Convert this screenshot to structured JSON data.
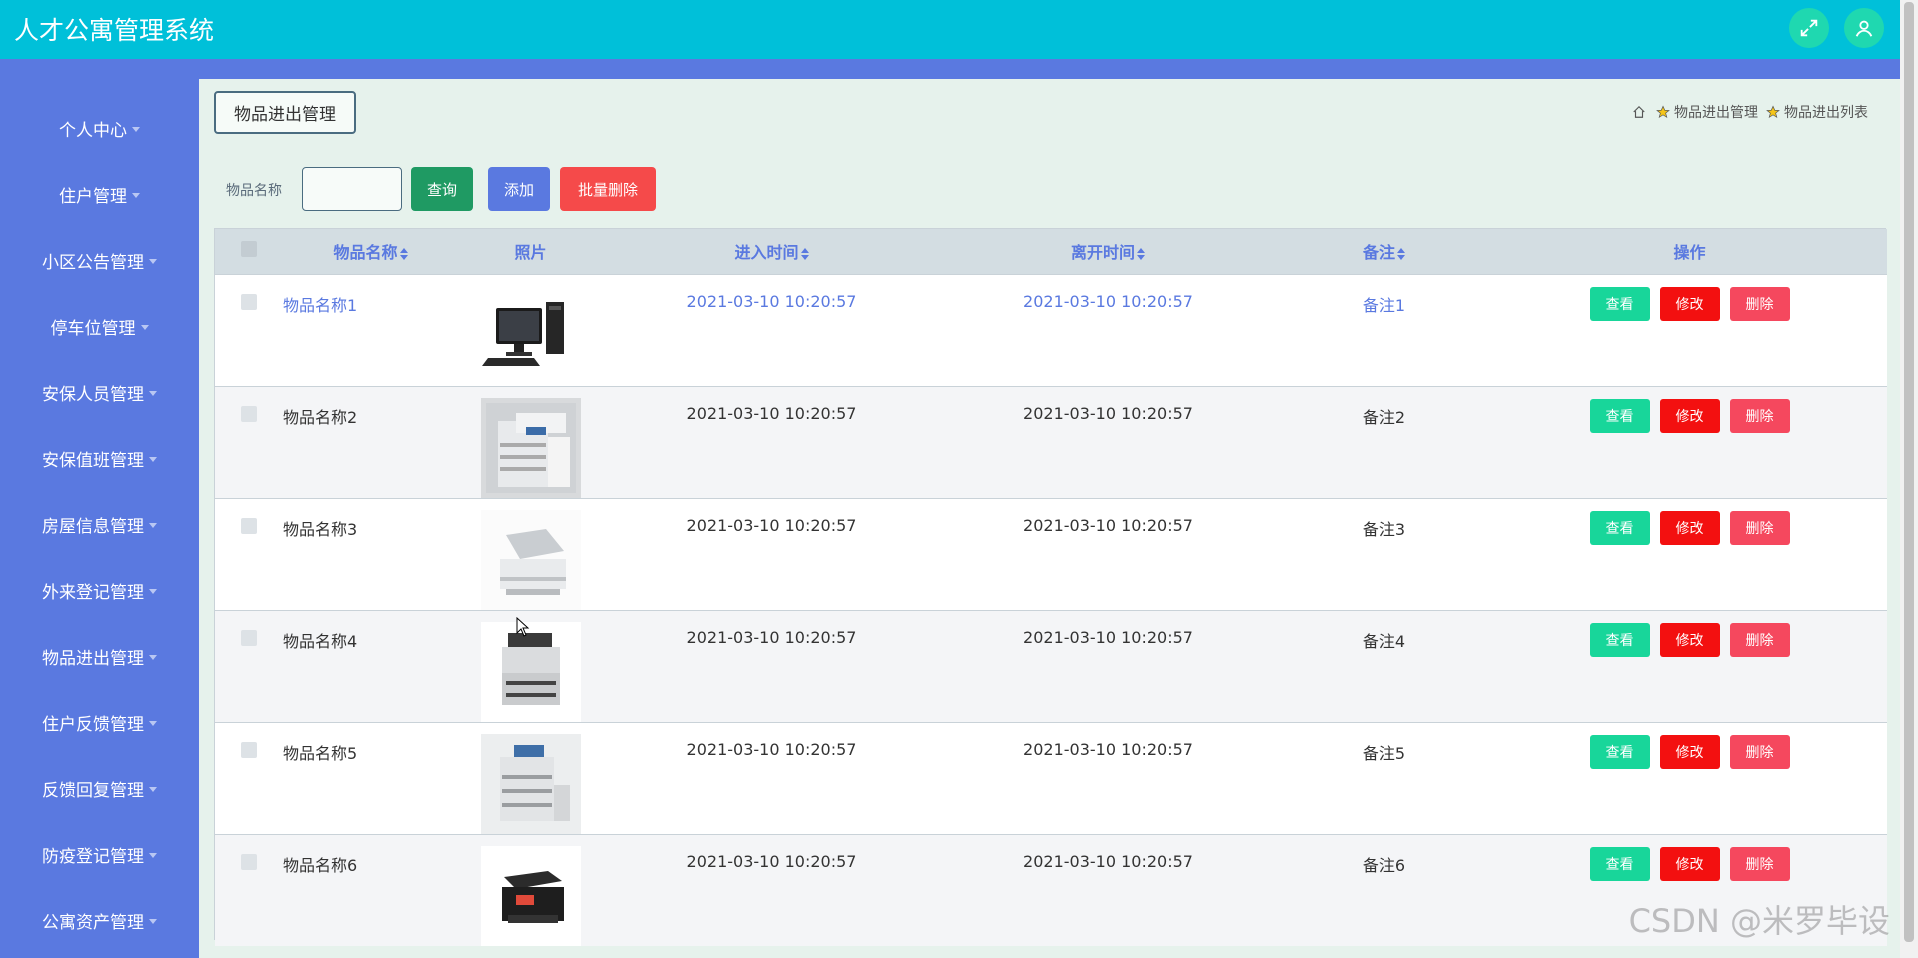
{
  "header": {
    "title": "人才公寓管理系统",
    "fullscreen_icon": "fullscreen-icon",
    "user_icon": "user-icon"
  },
  "sidebar": {
    "items": [
      {
        "label": "个人中心"
      },
      {
        "label": "住户管理"
      },
      {
        "label": "小区公告管理"
      },
      {
        "label": "停车位管理"
      },
      {
        "label": "安保人员管理"
      },
      {
        "label": "安保值班管理"
      },
      {
        "label": "房屋信息管理"
      },
      {
        "label": "外来登记管理"
      },
      {
        "label": "物品进出管理"
      },
      {
        "label": "住户反馈管理"
      },
      {
        "label": "反馈回复管理"
      },
      {
        "label": "防疫登记管理"
      },
      {
        "label": "公寓资产管理"
      }
    ]
  },
  "main": {
    "page_tag": "物品进出管理",
    "breadcrumb": {
      "items": [
        "物品进出管理",
        "物品进出列表"
      ]
    },
    "search": {
      "label": "物品名称",
      "value": "",
      "query_label": "查询",
      "add_label": "添加",
      "batch_delete_label": "批量删除"
    },
    "table": {
      "columns": [
        "物品名称",
        "照片",
        "进入时间",
        "离开时间",
        "备注",
        "操作"
      ],
      "rows": [
        {
          "name": "物品名称1",
          "photo": "computer",
          "enter": "2021-03-10 10:20:57",
          "leave": "2021-03-10 10:20:57",
          "note": "备注1"
        },
        {
          "name": "物品名称2",
          "photo": "copier",
          "enter": "2021-03-10 10:20:57",
          "leave": "2021-03-10 10:20:57",
          "note": "备注2"
        },
        {
          "name": "物品名称3",
          "photo": "scanner",
          "enter": "2021-03-10 10:20:57",
          "leave": "2021-03-10 10:20:57",
          "note": "备注3"
        },
        {
          "name": "物品名称4",
          "photo": "printer",
          "enter": "2021-03-10 10:20:57",
          "leave": "2021-03-10 10:20:57",
          "note": "备注4"
        },
        {
          "name": "物品名称5",
          "photo": "copier-large",
          "enter": "2021-03-10 10:20:57",
          "leave": "2021-03-10 10:20:57",
          "note": "备注5"
        },
        {
          "name": "物品名称6",
          "photo": "inkjet-printer",
          "enter": "2021-03-10 10:20:57",
          "leave": "2021-03-10 10:20:57",
          "note": "备注6"
        }
      ],
      "actions": {
        "view": "查看",
        "edit": "修改",
        "delete": "删除"
      }
    }
  },
  "watermark": "CSDN @米罗毕设",
  "colors": {
    "header_bg": "#00c0d9",
    "sidebar_bg": "#5a79e0",
    "view_btn": "#18d69a",
    "edit_btn": "#f31010",
    "delete_btn": "#f5485e"
  }
}
